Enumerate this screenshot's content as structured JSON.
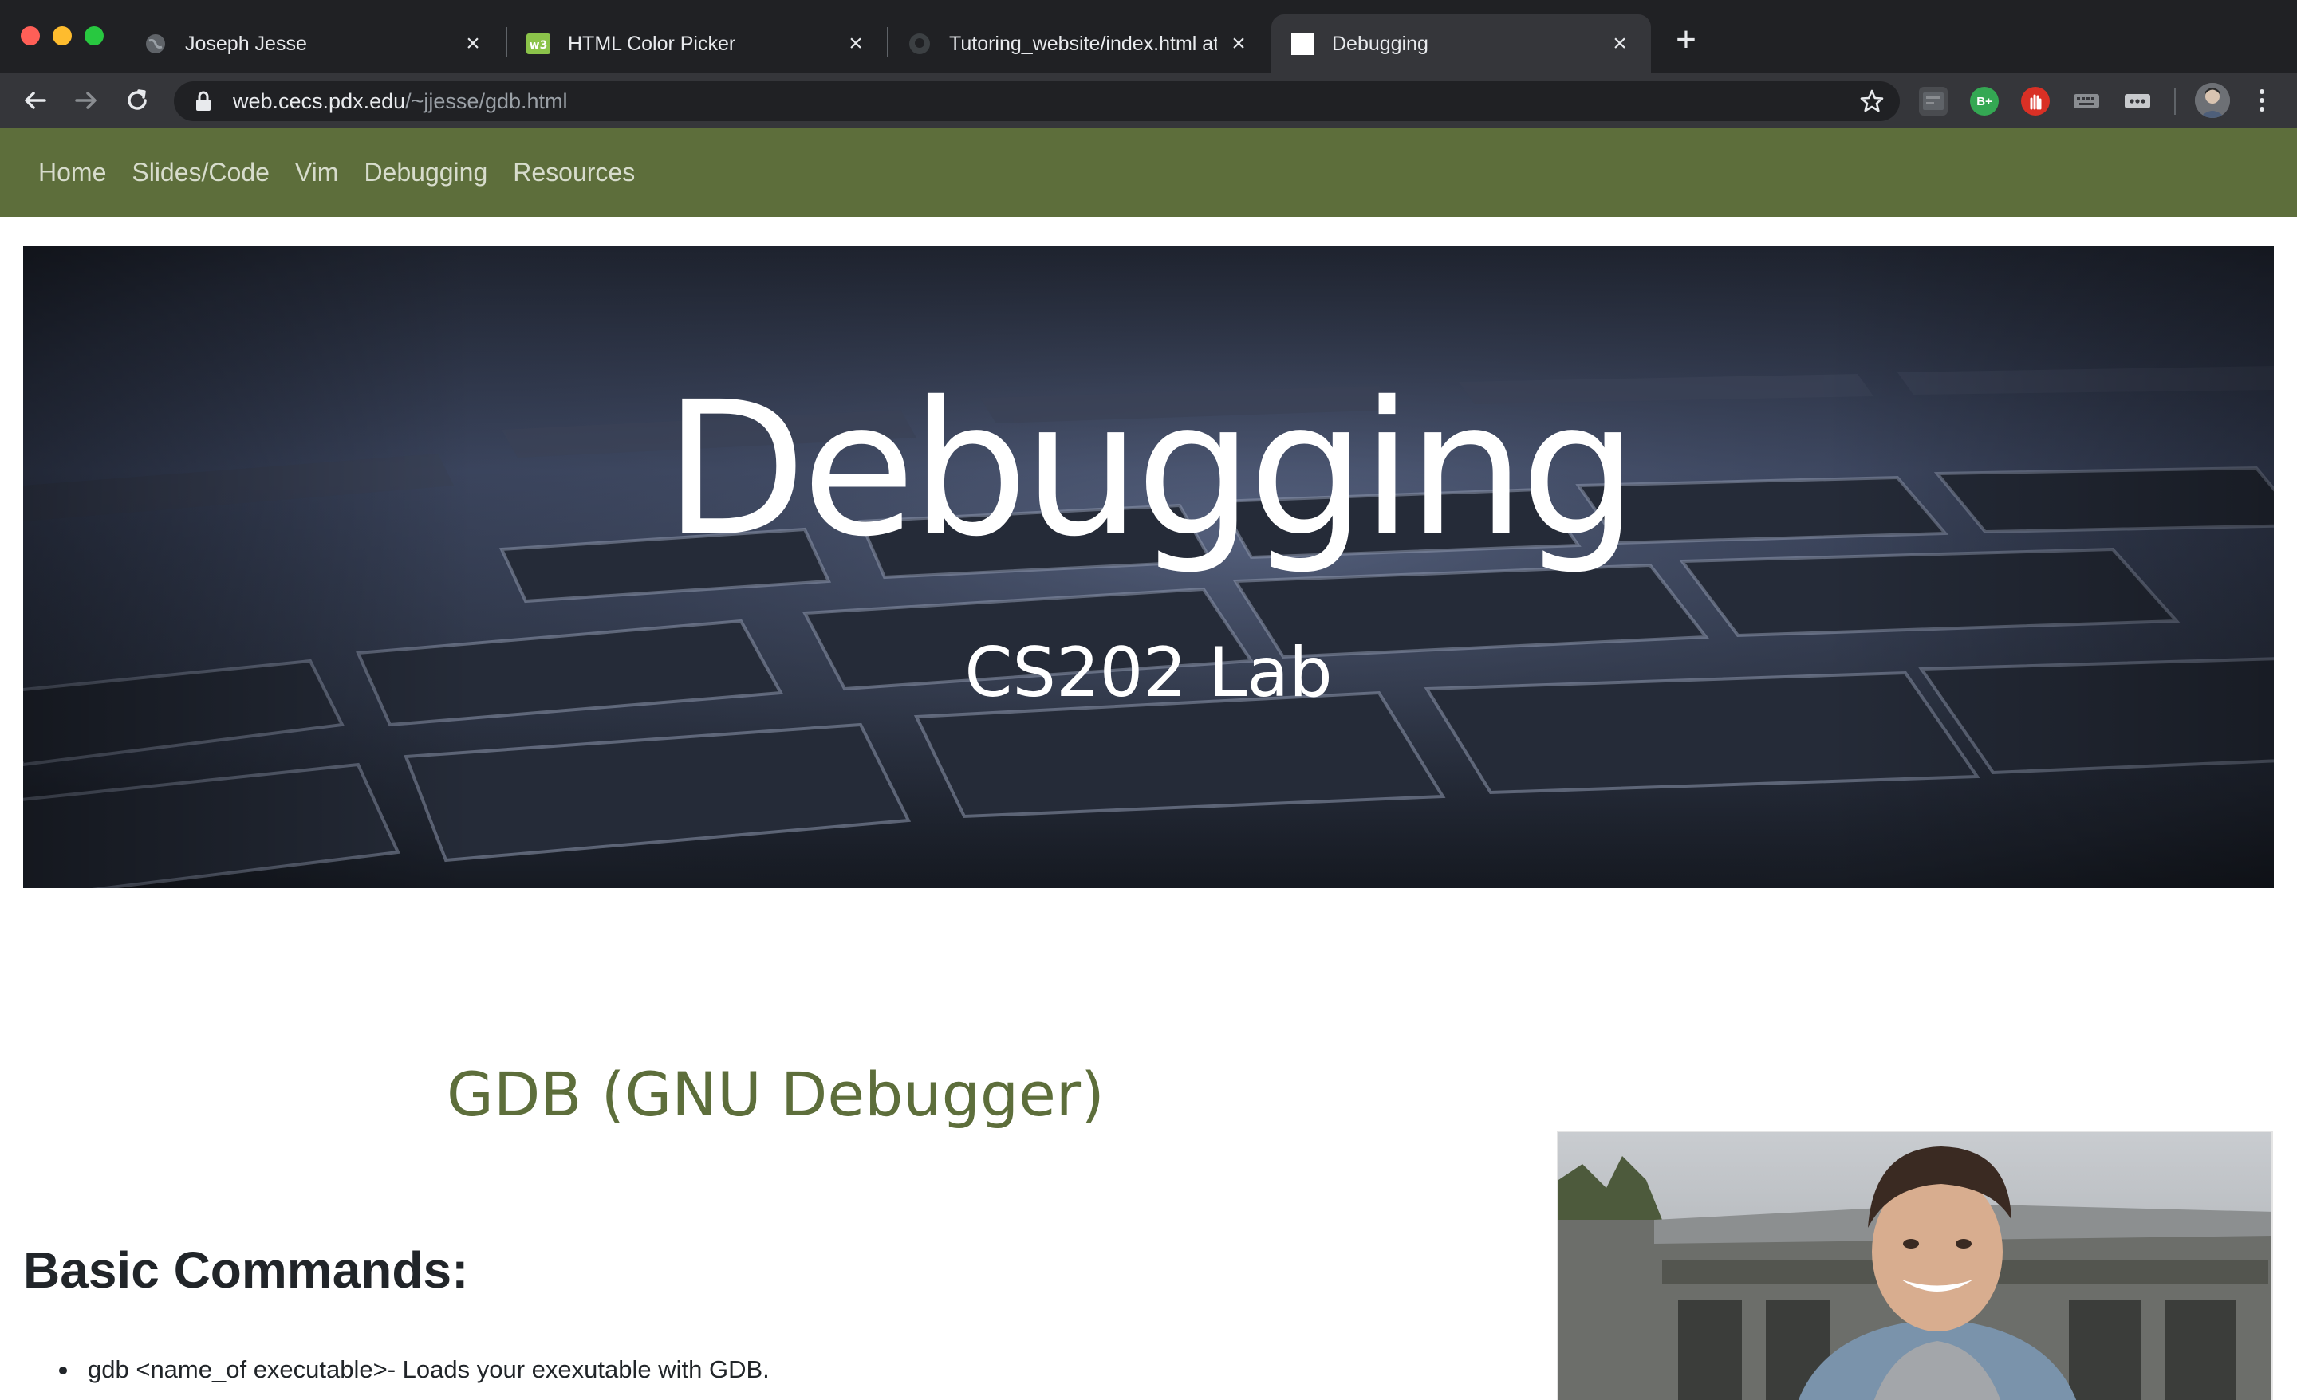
{
  "browser": {
    "tabs": [
      {
        "title": "Joseph Jesse",
        "favicon": "globe-icon",
        "active": false
      },
      {
        "title": "HTML Color Picker",
        "favicon": "w3schools-icon",
        "active": false
      },
      {
        "title": "Tutoring_website/index.html at m",
        "favicon": "github-icon",
        "active": false
      },
      {
        "title": "Debugging",
        "favicon": "blank-page-icon",
        "active": true
      }
    ],
    "url_host": "web.cecs.pdx.edu",
    "url_path": "/~jjesse/gdb.html",
    "extensions": [
      "adblock-extension",
      "grammar-b-plus-extension",
      "stop-hand-extension",
      "keyboard-extension",
      "more-dots-extension"
    ],
    "extension_labels": {
      "b_plus": "B+"
    }
  },
  "site": {
    "nav": [
      "Home",
      "Slides/Code",
      "Vim",
      "Debugging",
      "Resources"
    ],
    "hero": {
      "title": "Debugging",
      "subtitle": "CS202 Lab"
    },
    "section_title": "GDB (GNU Debugger)",
    "commands_heading": "Basic Commands:",
    "commands": [
      "gdb <name_of executable>- Loads your exexutable with GDB."
    ]
  },
  "colors": {
    "nav_bg": "#5d6e3b",
    "section_title": "#5d6e3b",
    "chrome_dark": "#202124",
    "chrome_toolbar": "#35363a"
  }
}
